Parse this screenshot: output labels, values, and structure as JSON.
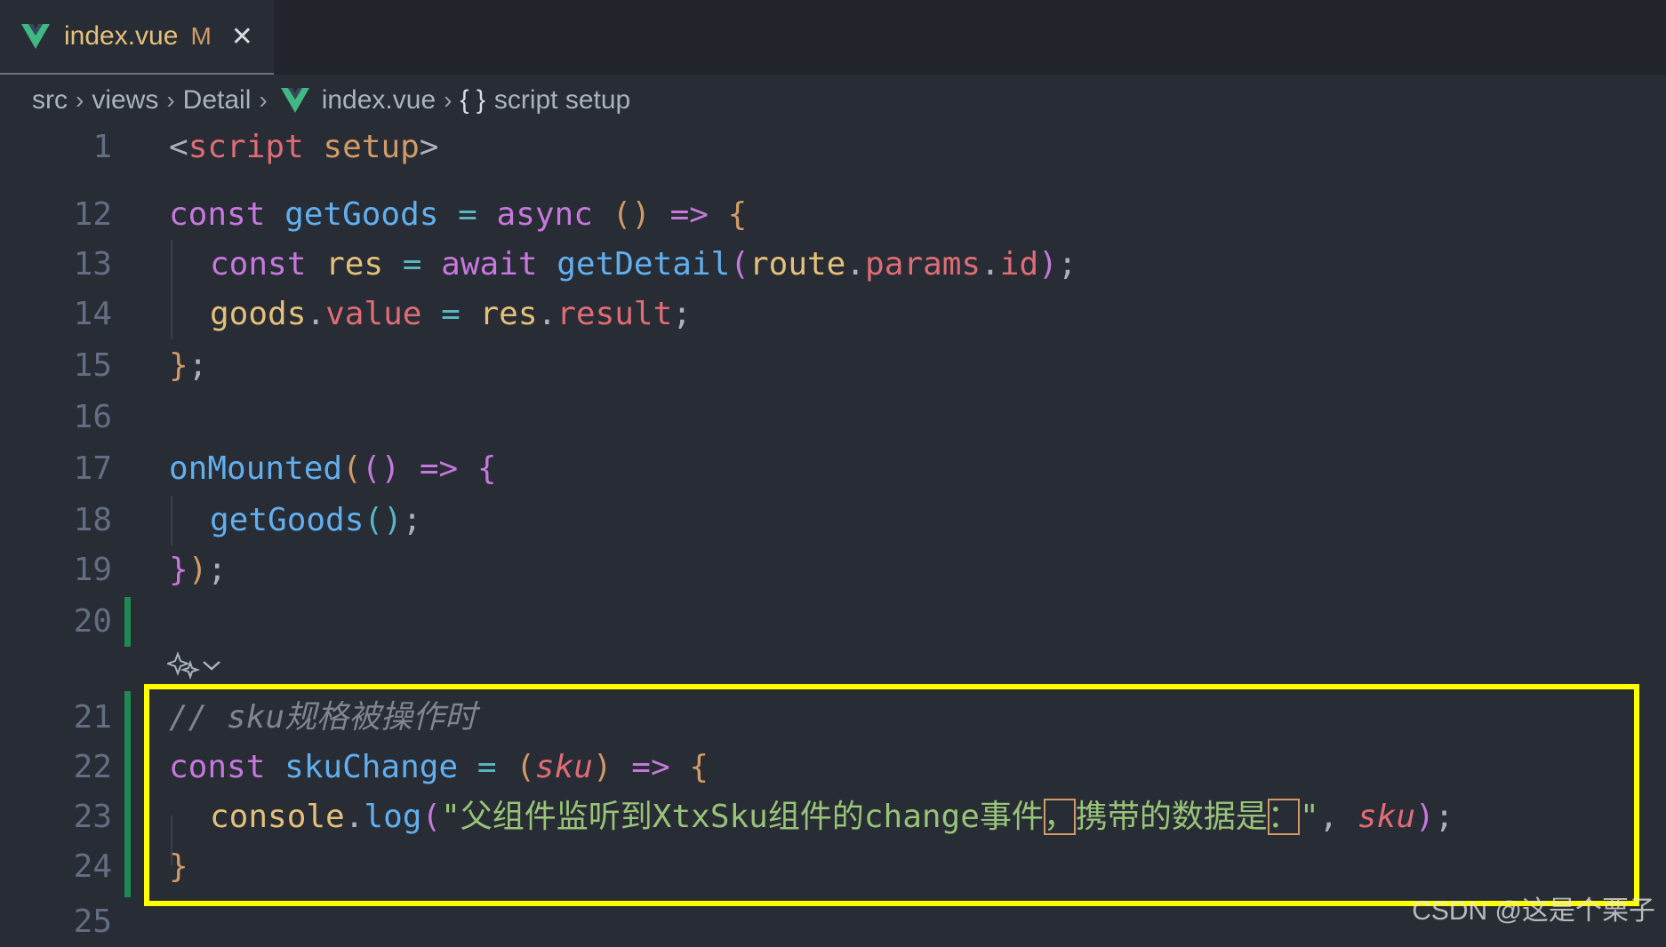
{
  "tab": {
    "filename": "index.vue",
    "modified": "M",
    "close": "✕"
  },
  "breadcrumb": {
    "items": [
      "src",
      "views",
      "Detail",
      "index.vue",
      "script setup"
    ],
    "braces": "{ }",
    "separator": "›"
  },
  "code": {
    "l1": {
      "num": "1",
      "open": "<",
      "tag": "script",
      "attr": "setup",
      "close": ">"
    },
    "l12": {
      "num": "12",
      "kw": "const",
      "name": "getGoods",
      "eq": "=",
      "async": "async",
      "parens": "()",
      "arrow": "=>",
      "brace": "{"
    },
    "l13": {
      "num": "13",
      "kw": "const",
      "name": "res",
      "eq": "=",
      "await": "await",
      "fn": "getDetail",
      "lp": "(",
      "obj": "route",
      "dot1": ".",
      "prop1": "params",
      "dot2": ".",
      "prop2": "id",
      "rp": ")",
      "semi": ";"
    },
    "l14": {
      "num": "14",
      "obj": "goods",
      "dot1": ".",
      "prop": "value",
      "eq": "=",
      "obj2": "res",
      "dot2": ".",
      "prop2": "result",
      "semi": ";"
    },
    "l15": {
      "num": "15",
      "brace": "}",
      "semi": ";"
    },
    "l16": {
      "num": "16"
    },
    "l17": {
      "num": "17",
      "fn": "onMounted",
      "lp": "(",
      "parens": "()",
      "arrow": "=>",
      "brace": "{"
    },
    "l18": {
      "num": "18",
      "fn": "getGoods",
      "parens": "()",
      "semi": ";"
    },
    "l19": {
      "num": "19",
      "brace": "}",
      "rp": ")",
      "semi": ";"
    },
    "l20": {
      "num": "20"
    },
    "l21": {
      "num": "21",
      "comment": "// sku规格被操作时"
    },
    "l22": {
      "num": "22",
      "kw": "const",
      "name": "skuChange",
      "eq": "=",
      "lp": "(",
      "param": "sku",
      "rp": ")",
      "arrow": "=>",
      "brace": "{"
    },
    "l23": {
      "num": "23",
      "obj": "console",
      "dot": ".",
      "fn": "log",
      "lp": "(",
      "str_a": "\"父组件监听到XtxSku组件的change事件",
      "str_comma": "，",
      "str_b": "携带的数据是",
      "str_colon": "：",
      "str_c": "\"",
      "comma": ",",
      "param": "sku",
      "rp": ")",
      "semi": ";"
    },
    "l24": {
      "num": "24",
      "brace": "}"
    },
    "l25": {
      "num": "25"
    }
  },
  "watermark": "CSDN @这是个栗子",
  "colors": {
    "editor_bg": "#282c34",
    "keyword": "#c678dd",
    "function": "#61afef",
    "variable": "#e5c07b",
    "property": "#e06c75",
    "string": "#98c379",
    "comment": "#7f848e",
    "highlight_box": "#ffff00",
    "git_added": "#1d8a4f"
  },
  "icons": {
    "vue": "vue-logo-icon",
    "codelens": "sparkle-icon",
    "chevron": "chevron-down-icon"
  }
}
